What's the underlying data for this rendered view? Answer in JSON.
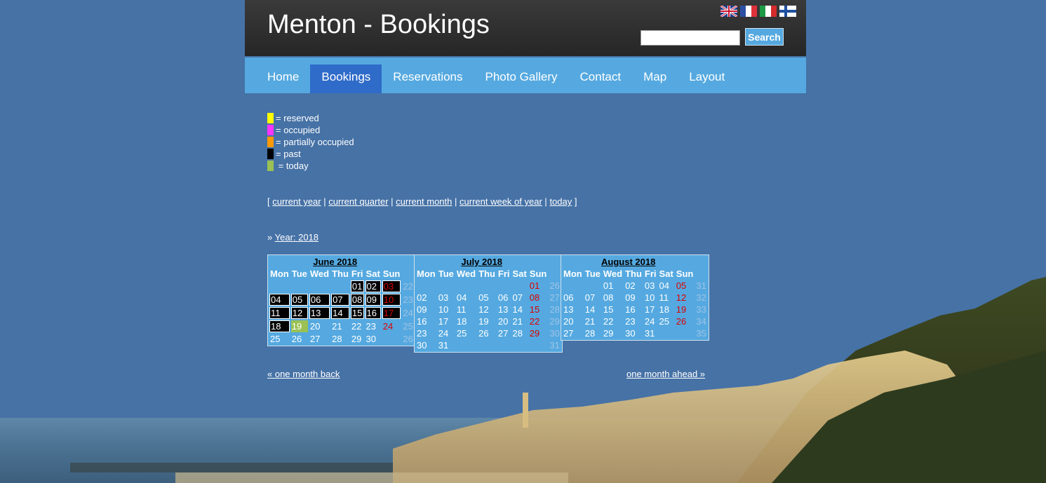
{
  "site": {
    "title": "Menton - Bookings"
  },
  "flags": [
    {
      "icon": "uk-flag-icon"
    },
    {
      "icon": "france-flag-icon"
    },
    {
      "icon": "italy-flag-icon"
    },
    {
      "icon": "finland-flag-icon"
    }
  ],
  "search": {
    "value": "",
    "button_label": "Search"
  },
  "nav": [
    {
      "label": "Home"
    },
    {
      "label": "Bookings",
      "active": true
    },
    {
      "label": "Reservations"
    },
    {
      "label": "Photo Gallery"
    },
    {
      "label": "Contact"
    },
    {
      "label": "Map"
    },
    {
      "label": "Layout"
    }
  ],
  "legend": [
    {
      "color": "#ffff00",
      "label": "= reserved"
    },
    {
      "color": "#ff33ff",
      "label": "= occupied"
    },
    {
      "color": "#ff9900",
      "label": "= partially occupied"
    },
    {
      "color": "#000000",
      "label": "= past"
    },
    {
      "color": "#9bc154",
      "label": " = today"
    }
  ],
  "period_links": {
    "open": "[",
    "close": "]",
    "sep": "|",
    "items": [
      "current year",
      "current quarter",
      "current month",
      "current week of year",
      "today"
    ]
  },
  "year_link": {
    "prefix": "»",
    "label": "Year: 2018"
  },
  "weekday_headers": [
    "Mon",
    "Tue",
    "Wed",
    "Thu",
    "Fri",
    "Sat",
    "Sun"
  ],
  "calendars": [
    {
      "title": "June 2018",
      "weeks": [
        {
          "days": [
            "",
            "",
            "",
            "",
            "01",
            "02",
            "03"
          ],
          "week": "22"
        },
        {
          "days": [
            "04",
            "05",
            "06",
            "07",
            "08",
            "09",
            "10"
          ],
          "week": "23"
        },
        {
          "days": [
            "11",
            "12",
            "13",
            "14",
            "15",
            "16",
            "17"
          ],
          "week": "24"
        },
        {
          "days": [
            "18",
            "19",
            "20",
            "21",
            "22",
            "23",
            "24"
          ],
          "week": "25"
        },
        {
          "days": [
            "25",
            "26",
            "27",
            "28",
            "29",
            "30",
            ""
          ],
          "week": "26"
        }
      ],
      "past_days": [
        "01",
        "02",
        "03",
        "04",
        "05",
        "06",
        "07",
        "08",
        "09",
        "10",
        "11",
        "12",
        "13",
        "14",
        "15",
        "16",
        "17",
        "18"
      ],
      "today": "19"
    },
    {
      "title": "July 2018",
      "weeks": [
        {
          "days": [
            "",
            "",
            "",
            "",
            "",
            "",
            "01"
          ],
          "week": "26"
        },
        {
          "days": [
            "02",
            "03",
            "04",
            "05",
            "06",
            "07",
            "08"
          ],
          "week": "27"
        },
        {
          "days": [
            "09",
            "10",
            "11",
            "12",
            "13",
            "14",
            "15"
          ],
          "week": "28"
        },
        {
          "days": [
            "16",
            "17",
            "18",
            "19",
            "20",
            "21",
            "22"
          ],
          "week": "29"
        },
        {
          "days": [
            "23",
            "24",
            "25",
            "26",
            "27",
            "28",
            "29"
          ],
          "week": "30"
        },
        {
          "days": [
            "30",
            "31",
            "",
            "",
            "",
            "",
            ""
          ],
          "week": "31"
        }
      ],
      "past_days": [],
      "today": ""
    },
    {
      "title": "August 2018",
      "weeks": [
        {
          "days": [
            "",
            "",
            "01",
            "02",
            "03",
            "04",
            "05"
          ],
          "week": "31"
        },
        {
          "days": [
            "06",
            "07",
            "08",
            "09",
            "10",
            "11",
            "12"
          ],
          "week": "32"
        },
        {
          "days": [
            "13",
            "14",
            "15",
            "16",
            "17",
            "18",
            "19"
          ],
          "week": "33"
        },
        {
          "days": [
            "20",
            "21",
            "22",
            "23",
            "24",
            "25",
            "26"
          ],
          "week": "34"
        },
        {
          "days": [
            "27",
            "28",
            "29",
            "30",
            "31",
            "",
            ""
          ],
          "week": "35"
        }
      ],
      "past_days": [],
      "today": ""
    }
  ],
  "month_nav": {
    "back": "« one month back",
    "ahead": "one month ahead »"
  }
}
